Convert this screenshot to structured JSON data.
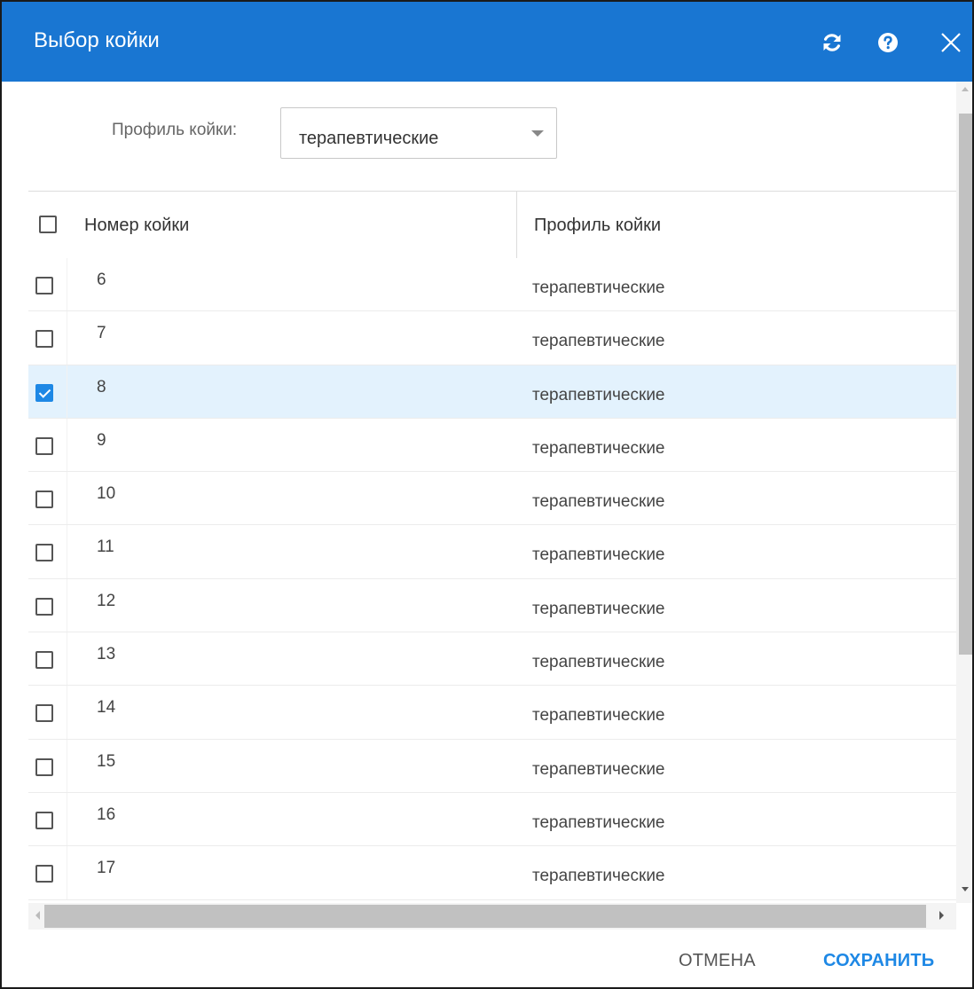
{
  "dialog": {
    "title": "Выбор койки",
    "icons": [
      "refresh-icon",
      "help-icon",
      "close-icon"
    ],
    "accent_color": "#1976d2"
  },
  "filter": {
    "label": "Профиль койки:",
    "selected_value": "терапевтические"
  },
  "grid": {
    "columns": [
      "Номер койки",
      "Профиль койки"
    ],
    "rows": [
      {
        "number": "6",
        "profile": "терапевтические",
        "checked": false
      },
      {
        "number": "7",
        "profile": "терапевтические",
        "checked": false
      },
      {
        "number": "8",
        "profile": "терапевтические",
        "checked": true
      },
      {
        "number": "9",
        "profile": "терапевтические",
        "checked": false
      },
      {
        "number": "10",
        "profile": "терапевтические",
        "checked": false
      },
      {
        "number": "11",
        "profile": "терапевтические",
        "checked": false
      },
      {
        "number": "12",
        "profile": "терапевтические",
        "checked": false
      },
      {
        "number": "13",
        "profile": "терапевтические",
        "checked": false
      },
      {
        "number": "14",
        "profile": "терапевтические",
        "checked": false
      },
      {
        "number": "15",
        "profile": "терапевтические",
        "checked": false
      },
      {
        "number": "16",
        "profile": "терапевтические",
        "checked": false
      },
      {
        "number": "17",
        "profile": "терапевтические",
        "checked": false
      }
    ],
    "selected_row_color": "#e3f2fd",
    "checkbox_color": "#1e88e5"
  },
  "footer": {
    "cancel_label": "Отмена",
    "save_label": "Сохранить"
  }
}
